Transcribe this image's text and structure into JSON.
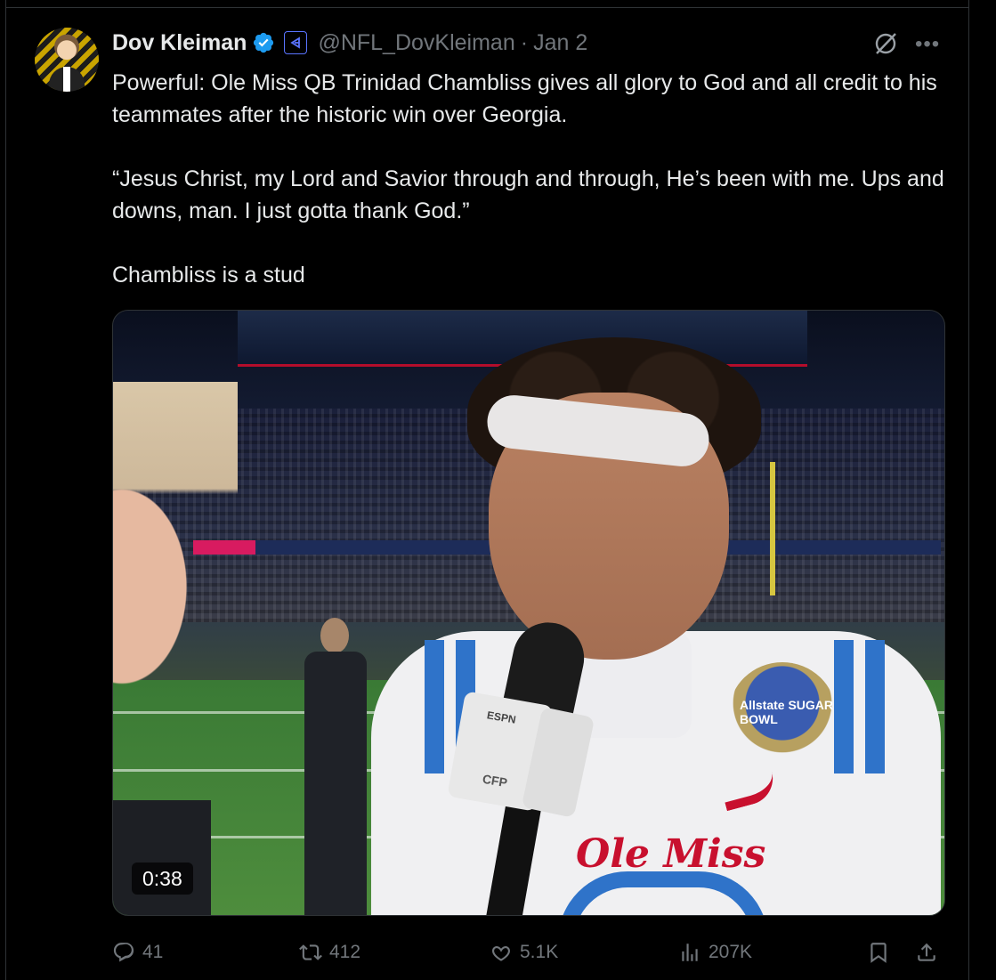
{
  "author": {
    "name": "Dov Kleiman",
    "handle": "@NFL_DovKleiman",
    "separator": "·",
    "date": "Jan 2"
  },
  "tweet": {
    "paragraphs": [
      "Powerful: Ole Miss QB Trinidad Chambliss gives all glory to God and all credit to his teammates after the historic win over Georgia.",
      "“Jesus Christ, my Lord and Savior through and through, He’s been with me. Ups and downs, man. I just gotta thank God.”",
      "Chambliss is a stud"
    ]
  },
  "media": {
    "duration": "0:38",
    "jersey_text": "Ole Miss",
    "patch_text": "Allstate SUGAR BOWL",
    "mic_brand": "ESPN",
    "mic_flag": "CFP"
  },
  "actions": {
    "replies": "41",
    "reposts": "412",
    "likes": "5.1K",
    "views": "207K"
  },
  "icons": {
    "verified": "verified-badge-icon",
    "affiliate": "affiliate-badge-icon",
    "grok": "grok-icon",
    "more": "more-icon",
    "reply": "reply-icon",
    "repost": "repost-icon",
    "like": "like-icon",
    "views": "views-icon",
    "bookmark": "bookmark-icon",
    "share": "share-icon"
  },
  "colors": {
    "background": "#000000",
    "text": "#e7e9ea",
    "muted": "#71767b",
    "verified_blue": "#1d9bf0"
  }
}
